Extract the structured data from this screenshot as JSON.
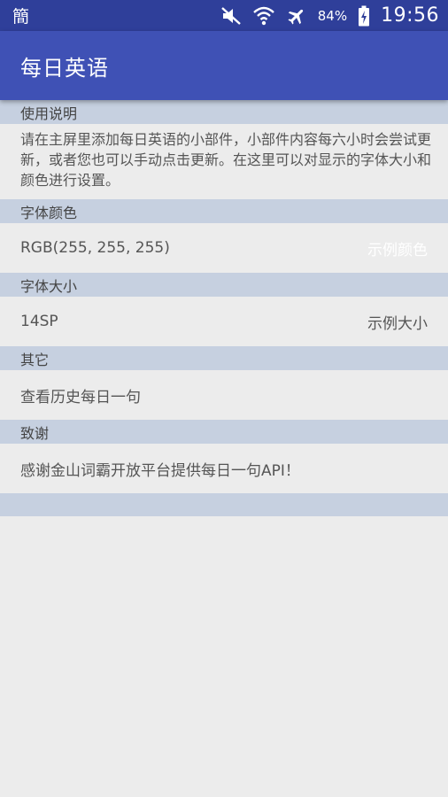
{
  "status_bar": {
    "input_method": "簡",
    "battery_percent": "84%",
    "time": "19:56",
    "icons": [
      "mute-icon",
      "wifi-icon",
      "airplane-mode-icon",
      "battery-charging-icon"
    ]
  },
  "app_bar": {
    "title": "每日英语"
  },
  "usage": {
    "header": "使用说明",
    "text": "请在主屏里添加每日英语的小部件，小部件内容每六小时会尝试更新，或者您也可以手动点击更新。在这里可以对显示的字体大小和颜色进行设置。"
  },
  "font_color": {
    "header": "字体颜色",
    "value": "RGB(255, 255, 255)",
    "sample": "示例颜色",
    "sample_color": "#ffffff"
  },
  "font_size": {
    "header": "字体大小",
    "value": "14SP",
    "sample": "示例大小"
  },
  "other": {
    "header": "其它",
    "history": "查看历史每日一句"
  },
  "thanks": {
    "header": "致谢",
    "text": "感谢金山词霸开放平台提供每日一句API！"
  },
  "colors": {
    "status_bar": "#2f3f9a",
    "app_bar": "#3f51b5",
    "section_header": "#c6d0e0",
    "background": "#ececec"
  }
}
